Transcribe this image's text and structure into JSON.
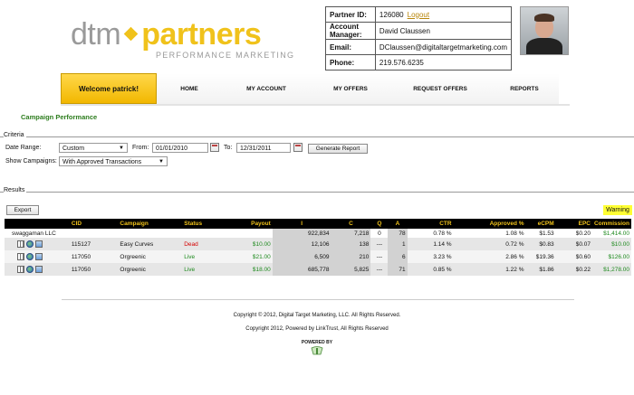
{
  "brand": {
    "logo_dtm": "dtm",
    "logo_partners": "partners",
    "tagline": "PERFORMANCE MARKETING",
    "accent_color": "#f0c21b"
  },
  "partner_info": {
    "rows": [
      {
        "label": "Partner ID:",
        "value": "126080",
        "link": "Logout"
      },
      {
        "label": "Account Manager:",
        "value": "David Claussen"
      },
      {
        "label": "Email:",
        "value": "DClaussen@digitaltargetmarketing.com"
      },
      {
        "label": "Phone:",
        "value": "219.576.6235"
      }
    ]
  },
  "nav": {
    "welcome": "Welcome patrick!",
    "tabs": [
      "HOME",
      "MY ACCOUNT",
      "MY OFFERS",
      "REQUEST OFFERS",
      "REPORTS"
    ]
  },
  "page_title": "Campaign Performance",
  "criteria": {
    "legend": "Criteria",
    "date_range_label": "Date Range:",
    "date_range_value": "Custom",
    "from_label": "From:",
    "from_value": "01/01/2010",
    "to_label": "To:",
    "to_value": "12/31/2011",
    "generate_label": "Generate Report",
    "show_campaigns_label": "Show Campaigns:",
    "show_campaigns_value": "With Approved Transactions"
  },
  "results": {
    "legend": "Results",
    "export_label": "Export",
    "warning_label": "Warning",
    "columns": [
      "",
      "CID",
      "Campaign",
      "Status",
      "Payout",
      "I",
      "C",
      "Q",
      "A",
      "CTR",
      "Approved %",
      "eCPM",
      "EPC",
      "Commission"
    ],
    "group_row": {
      "name": "swaggaman LLC",
      "i": "922,834",
      "c": "7,218",
      "q": "0",
      "a": "78",
      "ctr": "0.78 %",
      "approved": "1.08 %",
      "ecpm": "$1.53",
      "epc": "$0.20",
      "commission": "$1,414.00"
    },
    "rows": [
      {
        "cid": "115127",
        "campaign": "Easy Curves",
        "status": "Dead",
        "payout": "$10.00",
        "i": "12,106",
        "c": "138",
        "q": "---",
        "a": "1",
        "ctr": "1.14 %",
        "approved": "0.72 %",
        "ecpm": "$0.83",
        "epc": "$0.07",
        "commission": "$10.00"
      },
      {
        "cid": "117050",
        "campaign": "Orgreenic",
        "status": "Live",
        "payout": "$21.00",
        "i": "6,509",
        "c": "210",
        "q": "---",
        "a": "6",
        "ctr": "3.23 %",
        "approved": "2.86 %",
        "ecpm": "$19.36",
        "epc": "$0.60",
        "commission": "$126.00"
      },
      {
        "cid": "117050",
        "campaign": "Orgreenic",
        "status": "Live",
        "payout": "$18.00",
        "i": "685,778",
        "c": "5,825",
        "q": "---",
        "a": "71",
        "ctr": "0.85 %",
        "approved": "1.22 %",
        "ecpm": "$1.86",
        "epc": "$0.22",
        "commission": "$1,278.00"
      }
    ]
  },
  "footer": {
    "copyright1": "Copyright © 2012, Digital Target Marketing, LLC. All Rights Reserved.",
    "copyright2": "Copyright 2012, Powered by LinkTrust, All Rights Reserved",
    "powered_by": "POWERED BY"
  }
}
